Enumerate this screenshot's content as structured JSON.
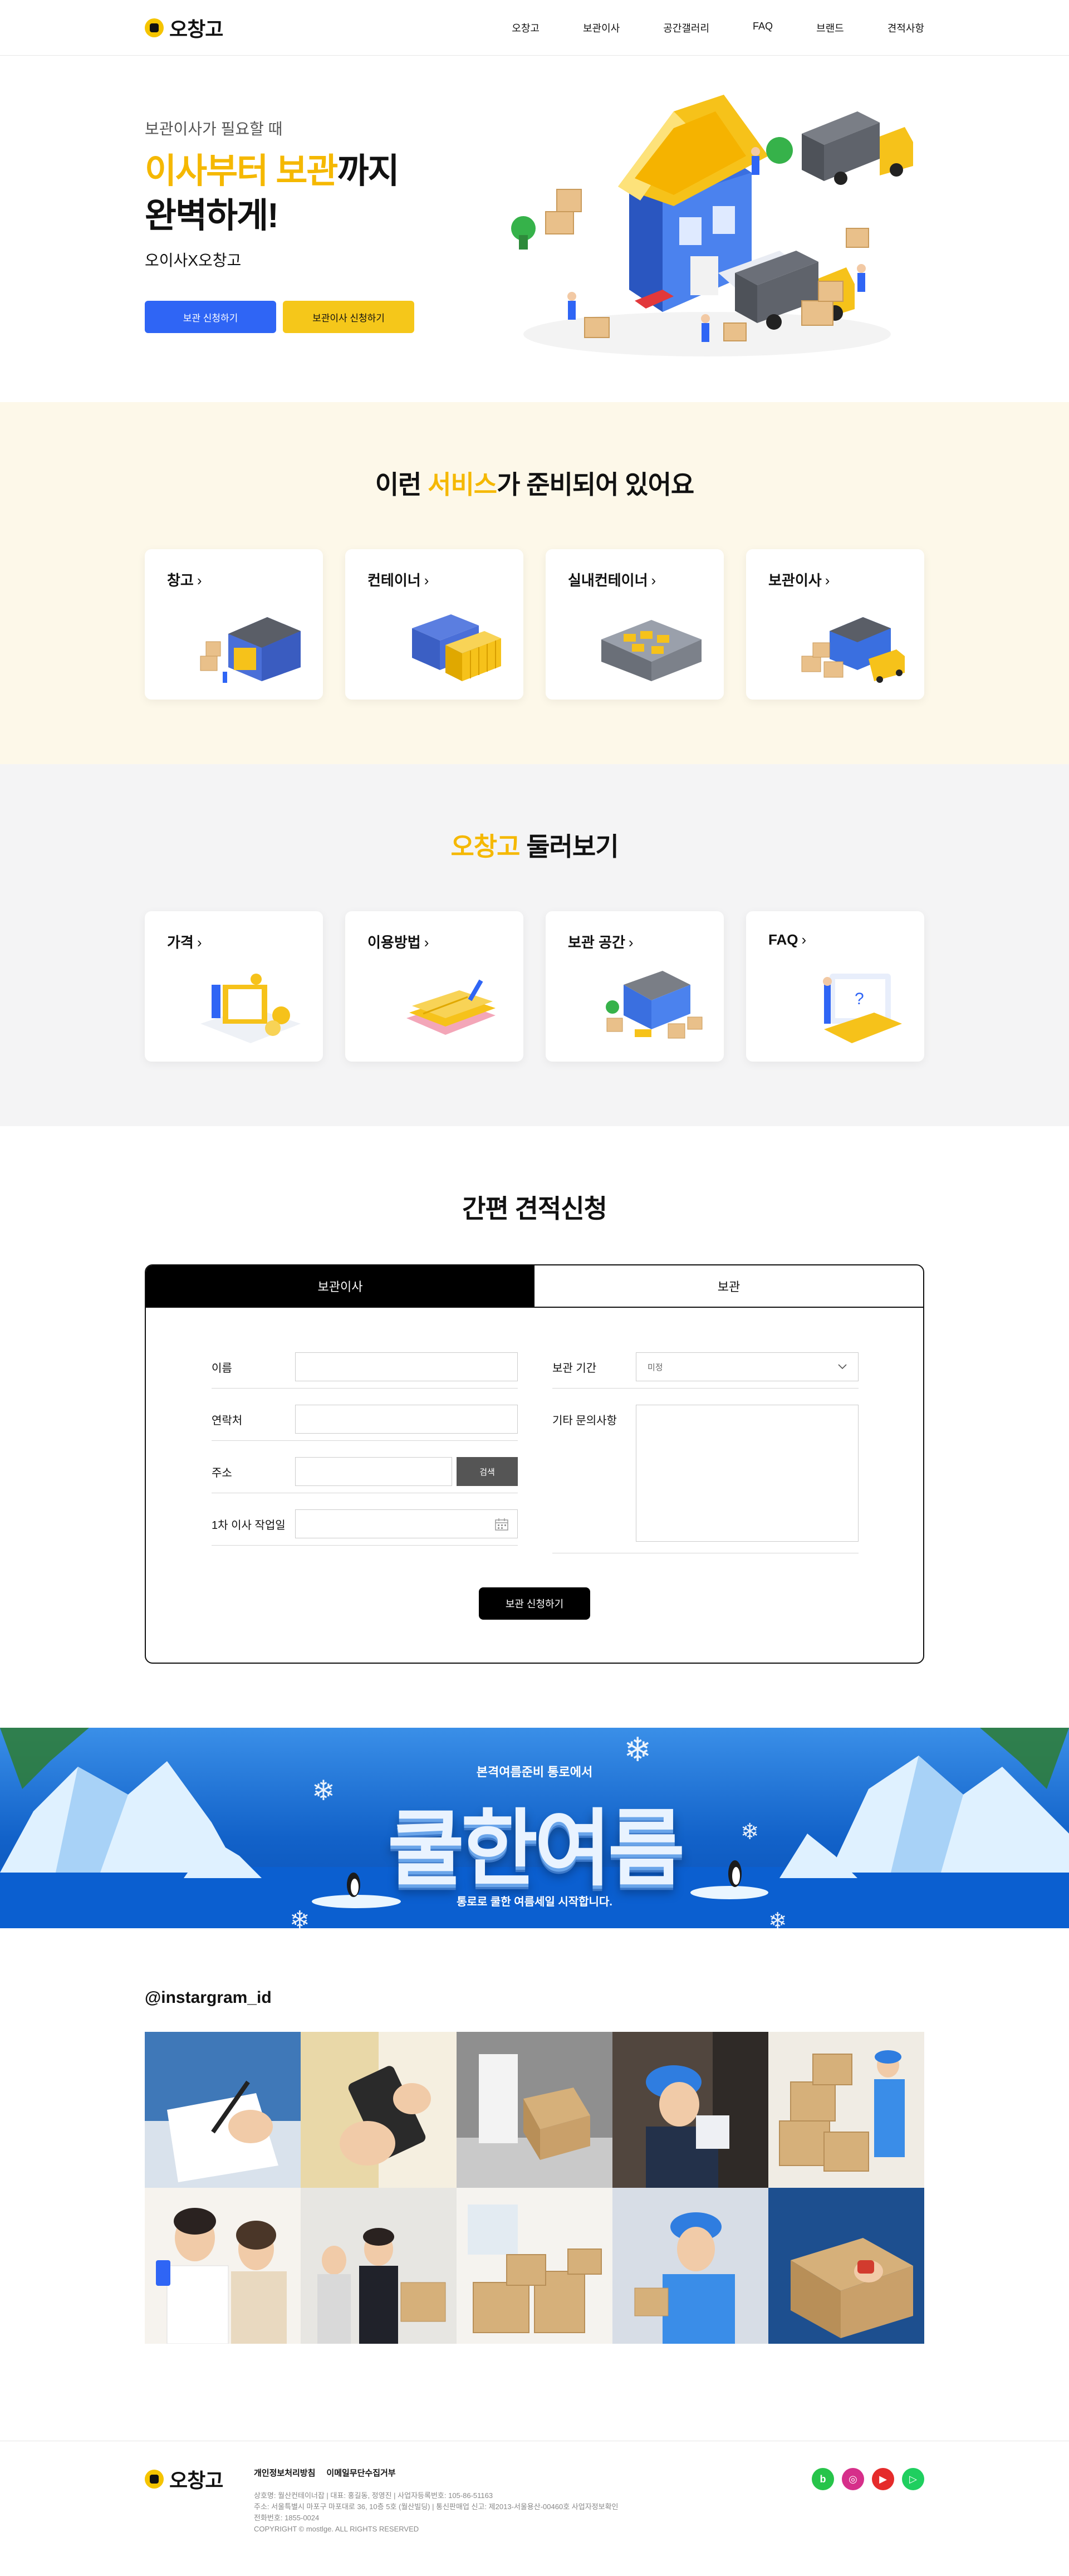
{
  "header": {
    "logo": "오창고",
    "nav": [
      "오창고",
      "보관이사",
      "공간갤러리",
      "FAQ",
      "브랜드",
      "견적사항"
    ]
  },
  "hero": {
    "subtitle": "보관이사가 필요할 때",
    "title_highlight": "이사부터 보관",
    "title_rest": "까지",
    "title_line2": "완벽하게!",
    "desc": "오이사X오창고",
    "btn_primary": "보관 신청하기",
    "btn_secondary": "보관이사 신청하기"
  },
  "services": {
    "title_pre": "이런 ",
    "title_highlight": "서비스",
    "title_post": "가 준비되어 있어요",
    "cards": [
      {
        "label": "창고",
        "icon": "warehouse-icon"
      },
      {
        "label": "컨테이너",
        "icon": "container-icon"
      },
      {
        "label": "실내컨테이너",
        "icon": "indoor-container-icon"
      },
      {
        "label": "보관이사",
        "icon": "storage-moving-icon"
      }
    ]
  },
  "browse": {
    "title_highlight": "오창고",
    "title_post": " 둘러보기",
    "cards": [
      {
        "label": "가격",
        "icon": "price-icon"
      },
      {
        "label": "이용방법",
        "icon": "guide-book-icon"
      },
      {
        "label": "보관 공간",
        "icon": "storage-space-icon"
      },
      {
        "label": "FAQ",
        "icon": "faq-icon"
      }
    ]
  },
  "quote": {
    "title": "간편 견적신청",
    "tabs": [
      "보관이사",
      "보관"
    ],
    "active_tab": 0,
    "fields": {
      "name": "이름",
      "phone": "연락처",
      "address": "주소",
      "search": "검색",
      "move_date": "1차 이사 작업일",
      "period": "보관 기간",
      "period_value": "미정",
      "memo": "기타 문의사항"
    },
    "submit": "보관 신청하기"
  },
  "banner": {
    "subtitle": "본격여름준비 통로에서",
    "title": "쿨한여름",
    "desc": "통로로 쿨한 여름세일 시작합니다."
  },
  "instagram": {
    "handle": "@instargram_id",
    "photos": [
      "clipboard-writing",
      "smartphone-hands",
      "carrying-box",
      "mover-cap-side",
      "box-stack-mover",
      "couple-phone",
      "office-team-boxes",
      "room-of-boxes",
      "mover-smiling",
      "tape-sealing-box"
    ]
  },
  "footer": {
    "logo": "오창고",
    "links": [
      "개인정보처리방침",
      "이메일무단수집거부"
    ],
    "info": [
      "상호명: 월산컨테이너잡  |  대표: 홍길동, 정영진  |  사업자등록번호: 105-86-51163",
      "주소: 서울특별시 마포구 마포대로 36, 10층 5호 (월산빌딩)  |  통신판매업 신고: 제2013-서울용산-00460호 사업자정보확인",
      "전화번호: 1855-0024",
      "COPYRIGHT © mostlge. ALL RIGHTS RESERVED"
    ],
    "social": [
      {
        "name": "blog",
        "color": "#27c44a",
        "glyph": "b"
      },
      {
        "name": "instagram",
        "color": "#d62f8a",
        "glyph": "◎"
      },
      {
        "name": "youtube",
        "color": "#e52b2b",
        "glyph": "▶"
      },
      {
        "name": "play",
        "color": "#1fcf5f",
        "glyph": "▷"
      }
    ]
  }
}
